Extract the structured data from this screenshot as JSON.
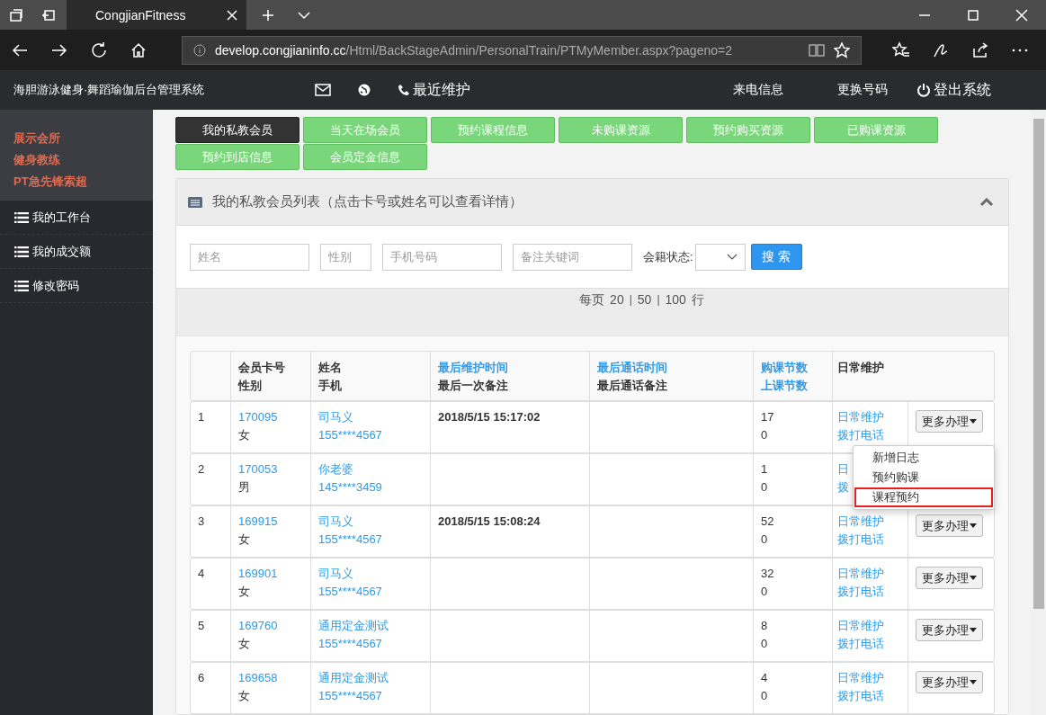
{
  "browser": {
    "tab_title": "CongjianFitness",
    "url_host": "develop.congjianinfo.cc",
    "url_path": "/Html/BackStageAdmin/PersonalTrain/PTMyMember.aspx?pageno=2"
  },
  "header": {
    "title": "海胆游泳健身·舞蹈瑜伽后台管理系统",
    "recent": "最近维护",
    "calls": "来电信息",
    "change_number": "更换号码",
    "logout": "登出系统"
  },
  "sidebar": {
    "profile": [
      "展示会所",
      "健身教练",
      "PT急先锋索超"
    ],
    "items": [
      {
        "label": "我的工作台"
      },
      {
        "label": "我的成交额"
      },
      {
        "label": "修改密码"
      }
    ]
  },
  "tabs": [
    {
      "label": "我的私教会员",
      "selected": true
    },
    {
      "label": "当天在场会员",
      "selected": false
    },
    {
      "label": "预约课程信息",
      "selected": false
    },
    {
      "label": "未购课资源",
      "selected": false
    },
    {
      "label": "预约购买资源",
      "selected": false
    },
    {
      "label": "已购课资源",
      "selected": false
    },
    {
      "label": "预约到店信息",
      "selected": false
    },
    {
      "label": "会员定金信息",
      "selected": false
    }
  ],
  "panel": {
    "title": "我的私教会员列表（点击卡号或姓名可以查看详情）",
    "expanded": true
  },
  "filters": {
    "name": {
      "placeholder": "姓名"
    },
    "gender": {
      "placeholder": "性别"
    },
    "phone": {
      "placeholder": "手机号码"
    },
    "note": {
      "placeholder": "备注关键词"
    },
    "status_label": "会籍状态:",
    "search_button": "搜 索"
  },
  "pager": {
    "label": "每页",
    "sizes": [
      "20",
      "50",
      "100"
    ],
    "sep": "|",
    "unit": "行"
  },
  "table": {
    "columns": [
      [
        "会员卡号",
        "性别"
      ],
      [
        "姓名",
        "手机"
      ],
      [
        "最后维护时间",
        "最后一次备注"
      ],
      [
        "最后通话时间",
        "最后通话备注"
      ],
      [
        "购课节数",
        "上课节数"
      ],
      [
        "日常维护"
      ]
    ],
    "rows": [
      {
        "index": "1",
        "card": "170095",
        "gender": "女",
        "name": "司马义",
        "phone": "155****4567",
        "last_maint": "2018/5/15 15:17:02",
        "last_call": "",
        "bought": "17",
        "attended": "0",
        "links": [
          "日常维护",
          "拨打电话"
        ],
        "more": "更多办理"
      },
      {
        "index": "2",
        "card": "170053",
        "gender": "男",
        "name": "你老婆",
        "phone": "145****3459",
        "last_maint": "",
        "last_call": "",
        "bought": "1",
        "attended": "0",
        "links": [
          "日",
          "拨"
        ]
      },
      {
        "index": "3",
        "card": "169915",
        "gender": "女",
        "name": "司马义",
        "phone": "155****4567",
        "last_maint": "2018/5/15 15:08:24",
        "last_call": "",
        "bought": "52",
        "attended": "0",
        "links": [
          "日常维护",
          "拨打电话"
        ],
        "more": "更多办理"
      },
      {
        "index": "4",
        "card": "169901",
        "gender": "女",
        "name": "司马义",
        "phone": "155****4567",
        "last_maint": "",
        "last_call": "",
        "bought": "32",
        "attended": "0",
        "links": [
          "日常维护",
          "拨打电话"
        ],
        "more": "更多办理"
      },
      {
        "index": "5",
        "card": "169760",
        "gender": "女",
        "name": "通用定金测试",
        "phone": "155****4567",
        "last_maint": "",
        "last_call": "",
        "bought": "8",
        "attended": "0",
        "links": [
          "日常维护",
          "拨打电话"
        ],
        "more": "更多办理"
      },
      {
        "index": "6",
        "card": "169658",
        "gender": "女",
        "name": "通用定金测试",
        "phone": "155****4567",
        "last_maint": "",
        "last_call": "",
        "bought": "4",
        "attended": "0",
        "links": [
          "日常维护",
          "拨打电话"
        ],
        "more": "更多办理"
      }
    ]
  },
  "dropdown": {
    "items": [
      {
        "label": "新增日志",
        "highlighted": false
      },
      {
        "label": "预约购课",
        "highlighted": false
      },
      {
        "label": "课程预约",
        "highlighted": true
      }
    ]
  }
}
